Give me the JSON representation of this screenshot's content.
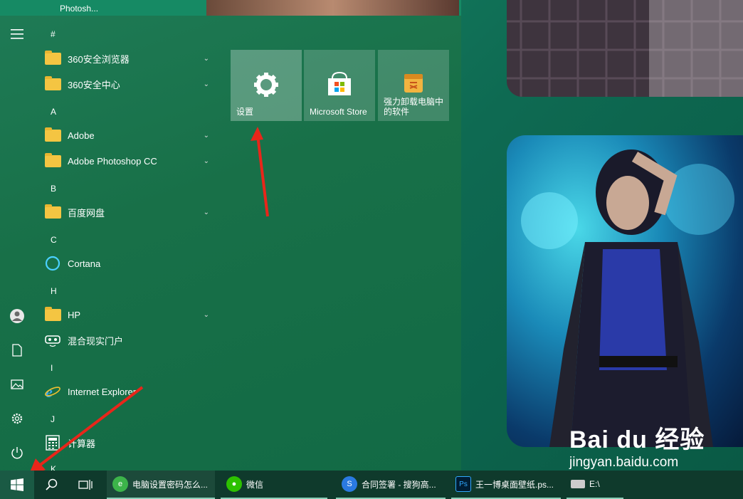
{
  "desktop": {
    "top_icon_label": "Photosh..."
  },
  "start_menu": {
    "rail_icons": [
      "hamburger-menu-icon",
      "user-icon",
      "document-icon",
      "pictures-icon",
      "settings-gear-icon",
      "power-icon"
    ],
    "apps": [
      {
        "type": "letter",
        "text": "#"
      },
      {
        "type": "app",
        "label": "360安全浏览器",
        "icon": "folder",
        "expandable": true
      },
      {
        "type": "app",
        "label": "360安全中心",
        "icon": "folder",
        "expandable": true
      },
      {
        "type": "letter",
        "text": "A"
      },
      {
        "type": "app",
        "label": "Adobe",
        "icon": "folder",
        "expandable": true
      },
      {
        "type": "app",
        "label": "Adobe Photoshop CC",
        "icon": "folder",
        "expandable": true
      },
      {
        "type": "letter",
        "text": "B"
      },
      {
        "type": "app",
        "label": "百度网盘",
        "icon": "folder",
        "expandable": true
      },
      {
        "type": "letter",
        "text": "C"
      },
      {
        "type": "app",
        "label": "Cortana",
        "icon": "cortana",
        "expandable": false
      },
      {
        "type": "letter",
        "text": "H"
      },
      {
        "type": "app",
        "label": "HP",
        "icon": "folder",
        "expandable": true
      },
      {
        "type": "app",
        "label": "混合现实门户",
        "icon": "mixed-reality",
        "expandable": false
      },
      {
        "type": "letter",
        "text": "I"
      },
      {
        "type": "app",
        "label": "Internet Explorer",
        "icon": "ie",
        "expandable": false
      },
      {
        "type": "letter",
        "text": "J"
      },
      {
        "type": "app",
        "label": "计算器",
        "icon": "calculator",
        "expandable": false
      },
      {
        "type": "letter",
        "text": "K"
      }
    ],
    "tiles": {
      "settings": "设置",
      "store": "Microsoft Store",
      "uninstall_line1": "强力卸载电脑中",
      "uninstall_line2": "的软件"
    }
  },
  "taskbar": {
    "items": [
      {
        "label": "电脑设置密码怎么...",
        "icon": "browser-360-icon",
        "color": "#3cb44a"
      },
      {
        "label": "微信",
        "icon": "wechat-icon",
        "color": "#2dc100"
      },
      {
        "label": "合同签署 - 搜狗高...",
        "icon": "sogou-browser-icon",
        "color": "#2a7ae2"
      },
      {
        "label": "王一博桌面壁纸.ps...",
        "icon": "photoshop-icon",
        "color": "#001d34"
      },
      {
        "label": "E:\\",
        "icon": "drive-icon",
        "color": "#cccccc"
      }
    ]
  },
  "watermark": {
    "main": "Bai du 经验",
    "sub": "jingyan.baidu.com"
  }
}
